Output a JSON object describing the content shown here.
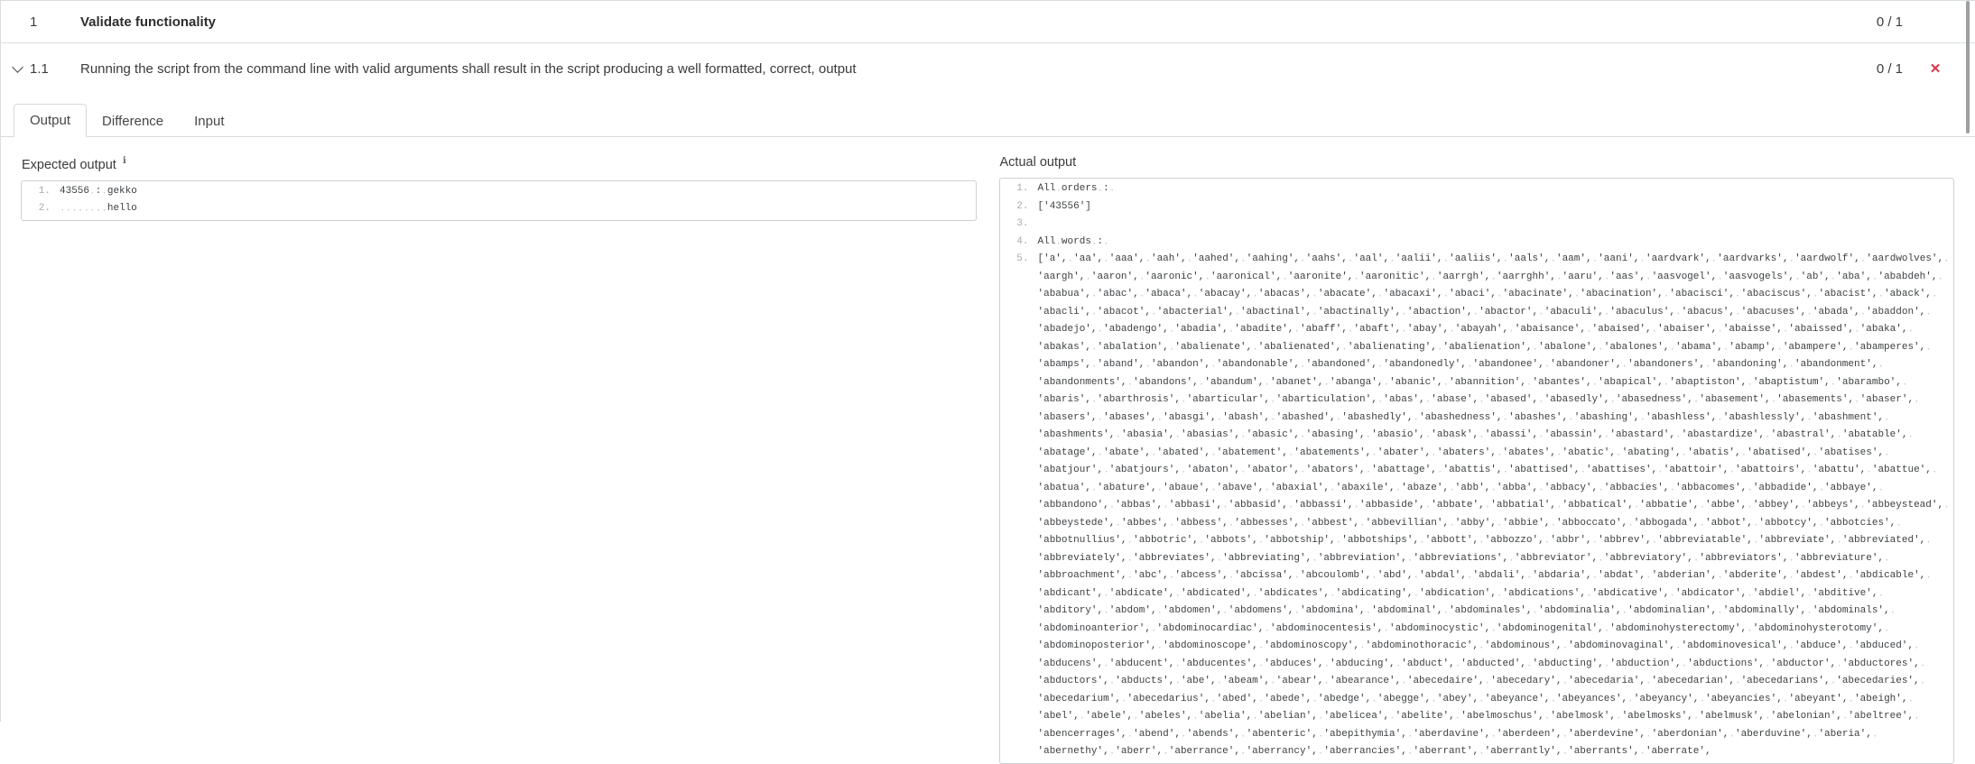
{
  "colors": {
    "fail_red": "#e2354b",
    "border_gray": "#dadde0",
    "line_number_gray": "#a6abb0",
    "whitespace_dot_gray": "#c6c6c6"
  },
  "steps": [
    {
      "number": "1",
      "title": "Validate functionality",
      "score": "0 / 1",
      "status_icon": ""
    },
    {
      "number": "1.1",
      "title": "Running the script from the command line with valid arguments shall result in the script producing a well formatted, correct, output",
      "score": "0 / 1",
      "status_icon": "✕"
    }
  ],
  "tabs": {
    "items": [
      {
        "label": "Output",
        "active": true
      },
      {
        "label": "Difference",
        "active": false
      },
      {
        "label": "Input",
        "active": false
      }
    ]
  },
  "output_tab": {
    "expected": {
      "label": "Expected output",
      "info_icon": "i",
      "lines": [
        "43556 : gekko",
        "        hello"
      ]
    },
    "actual": {
      "label": "Actual output",
      "lines": [
        "All orders : ",
        "['43556']",
        "",
        "All words : ",
        "['a', 'aa', 'aaa', 'aah', 'aahed', 'aahing', 'aahs', 'aal', 'aalii', 'aaliis', 'aals', 'aam', 'aani', 'aardvark', 'aardvarks', 'aardwolf', 'aardwolves', 'aargh', 'aaron', 'aaronic', 'aaronical', 'aaronite', 'aaronitic', 'aarrgh', 'aarrghh', 'aaru', 'aas', 'aasvogel', 'aasvogels', 'ab', 'aba', 'ababdeh', 'ababua', 'abac', 'abaca', 'abacay', 'abacas', 'abacate', 'abacaxi', 'abaci', 'abacinate', 'abacination', 'abacisci', 'abaciscus', 'abacist', 'aback', 'abacli', 'abacot', 'abacterial', 'abactinal', 'abactinally', 'abaction', 'abactor', 'abaculi', 'abaculus', 'abacus', 'abacuses', 'abada', 'abaddon', 'abadejo', 'abadengo', 'abadia', 'abadite', 'abaff', 'abaft', 'abay', 'abayah', 'abaisance', 'abaised', 'abaiser', 'abaisse', 'abaissed', 'abaka', 'abakas', 'abalation', 'abalienate', 'abalienated', 'abalienating', 'abalienation', 'abalone', 'abalones', 'abama', 'abamp', 'abampere', 'abamperes', 'abamps', 'aband', 'abandon', 'abandonable', 'abandoned', 'abandonedly', 'abandonee', 'abandoner', 'abandoners', 'abandoning', 'abandonment', 'abandonments', 'abandons', 'abandum', 'abanet', 'abanga', 'abanic', 'abannition', 'abantes', 'abapical', 'abaptiston', 'abaptistum', 'abarambo', 'abaris', 'abarthrosis', 'abarticular', 'abarticulation', 'abas', 'abase', 'abased', 'abasedly', 'abasedness', 'abasement', 'abasements', 'abaser', 'abasers', 'abases', 'abasgi', 'abash', 'abashed', 'abashedly', 'abashedness', 'abashes', 'abashing', 'abashless', 'abashlessly', 'abashment', 'abashments', 'abasia', 'abasias', 'abasic', 'abasing', 'abasio', 'abask', 'abassi', 'abassin', 'abastard', 'abastardize', 'abastral', 'abatable', 'abatage', 'abate', 'abated', 'abatement', 'abatements', 'abater', 'abaters', 'abates', 'abatic', 'abating', 'abatis', 'abatised', 'abatises', 'abatjour', 'abatjours', 'abaton', 'abator', 'abators', 'abattage', 'abattis', 'abattised', 'abattises', 'abattoir', 'abattoirs', 'abattu', 'abattue', 'abatua', 'abature', 'abaue', 'abave', 'abaxial', 'abaxile', 'abaze', 'abb', 'abba', 'abbacy', 'abbacies', 'abbacomes', 'abbadide', 'abbaye', 'abbandono', 'abbas', 'abbasi', 'abbasid', 'abbassi', 'abbaside', 'abbate', 'abbatial', 'abbatical', 'abbatie', 'abbe', 'abbey', 'abbeys', 'abbeystead', 'abbeystede', 'abbes', 'abbess', 'abbesses', 'abbest', 'abbevillian', 'abby', 'abbie', 'abboccato', 'abbogada', 'abbot', 'abbotcy', 'abbotcies', 'abbotnullius', 'abbotric', 'abbots', 'abbotship', 'abbotships', 'abbott', 'abbozzo', 'abbr', 'abbrev', 'abbreviatable', 'abbreviate', 'abbreviated', 'abbreviately', 'abbreviates', 'abbreviating', 'abbreviation', 'abbreviations', 'abbreviator', 'abbreviatory', 'abbreviators', 'abbreviature', 'abbroachment', 'abc', 'abcess', 'abcissa', 'abcoulomb', 'abd', 'abdal', 'abdali', 'abdaria', 'abdat', 'abderian', 'abderite', 'abdest', 'abdicable', 'abdicant', 'abdicate', 'abdicated', 'abdicates', 'abdicating', 'abdication', 'abdications', 'abdicative', 'abdicator', 'abdiel', 'abditive', 'abditory', 'abdom', 'abdomen', 'abdomens', 'abdomina', 'abdominal', 'abdominales', 'abdominalia', 'abdominalian', 'abdominally', 'abdominals', 'abdominoanterior', 'abdominocardiac', 'abdominocentesis', 'abdominocystic', 'abdominogenital', 'abdominohysterectomy', 'abdominohysterotomy', 'abdominoposterior', 'abdominoscope', 'abdominoscopy', 'abdominothoracic', 'abdominous', 'abdominovaginal', 'abdominovesical', 'abduce', 'abduced', 'abducens', 'abducent', 'abducentes', 'abduces', 'abducing', 'abduct', 'abducted', 'abducting', 'abduction', 'abductions', 'abductor', 'abductores', 'abductors', 'abducts', 'abe', 'abeam', 'abear', 'abearance', 'abecedaire', 'abecedary', 'abecedaria', 'abecedarian', 'abecedarians', 'abecedaries', 'abecedarium', 'abecedarius', 'abed', 'abede', 'abedge', 'abegge', 'abey', 'abeyance', 'abeyances', 'abeyancy', 'abeyancies', 'abeyant', 'abeigh', 'abel', 'abele', 'abeles', 'abelia', 'abelian', 'abelicea', 'abelite', 'abelmoschus', 'abelmosk', 'abelmosks', 'abelmusk', 'abelonian', 'abeltree', 'abencerrages', 'abend', 'abends', 'abenteric', 'abepithymia', 'aberdavine', 'aberdeen', 'aberdevine', 'aberdonian', 'aberduvine', 'aberia', 'abernethy', 'aberr', 'aberrance', 'aberrancy', 'aberrancies', 'aberrant', 'aberrantly', 'aberrants', 'aberrate',"
      ]
    }
  }
}
